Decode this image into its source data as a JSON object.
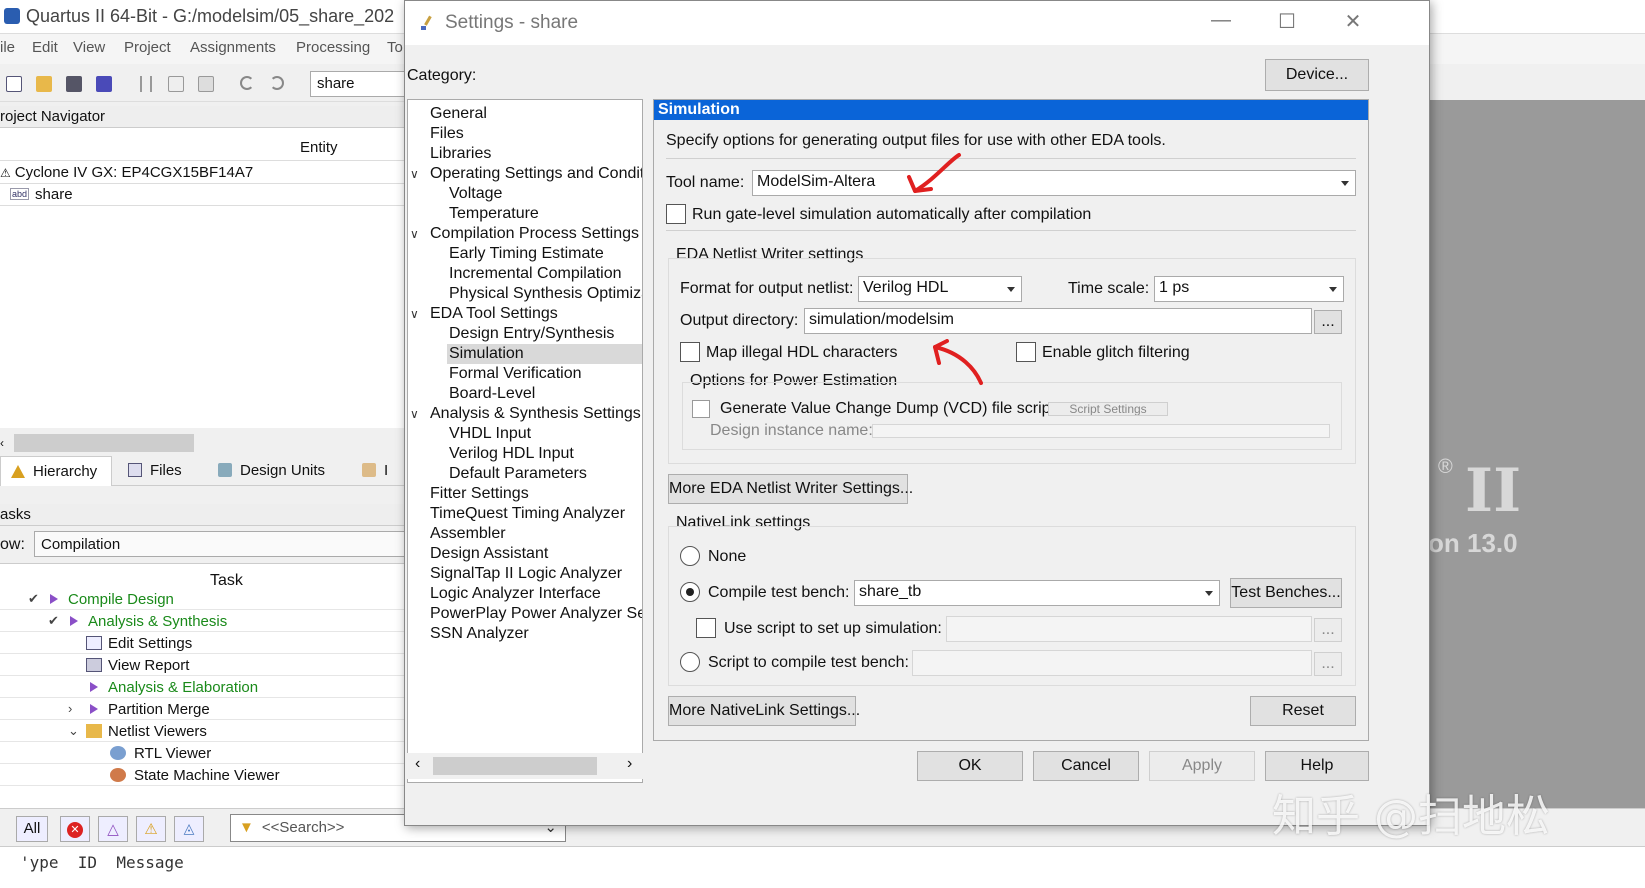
{
  "bg": {
    "title": "Quartus II 64-Bit - G:/modelsim/05_share_202",
    "menu": [
      "ile",
      "Edit",
      "View",
      "Project",
      "Assignments",
      "Processing",
      "To"
    ],
    "toolbar_combo": "share",
    "project_navigator": "roject Navigator",
    "entity_col": "Entity",
    "device": "Cyclone IV GX: EP4CGX15BF14A7",
    "top_entity": "share",
    "tabs": [
      "Hierarchy",
      "Files",
      "Design Units",
      "I"
    ],
    "tasks_header": "asks",
    "flow_label": "ow:",
    "flow_value": "Compilation",
    "task_col": "Task",
    "tasks": [
      {
        "label": "Compile Design"
      },
      {
        "label": "Analysis & Synthesis"
      },
      {
        "label": "Edit Settings"
      },
      {
        "label": "View Report"
      },
      {
        "label": "Analysis & Elaboration"
      },
      {
        "label": "Partition Merge"
      },
      {
        "label": "Netlist Viewers"
      },
      {
        "label": "RTL Viewer"
      },
      {
        "label": "State Machine Viewer"
      }
    ],
    "msg_all": "All",
    "search_placeholder": "<<Search>>",
    "msg_cols": "'ype  ID  Message",
    "splash_reg": "®",
    "splash_ii": "II",
    "splash_version": "on 13.0",
    "watermark": "知乎 @扫地松"
  },
  "dialog": {
    "title": "Settings - share",
    "category_label": "Category:",
    "device_button": "Device...",
    "categories": [
      "General",
      "Files",
      "Libraries",
      "Operating Settings and Conditic",
      "Voltage",
      "Temperature",
      "Compilation Process Settings",
      "Early Timing Estimate",
      "Incremental Compilation",
      "Physical Synthesis Optimizati",
      "EDA Tool Settings",
      "Design Entry/Synthesis",
      "Simulation",
      "Formal Verification",
      "Board-Level",
      "Analysis & Synthesis Settings",
      "VHDL Input",
      "Verilog HDL Input",
      "Default Parameters",
      "Fitter Settings",
      "TimeQuest Timing Analyzer",
      "Assembler",
      "Design Assistant",
      "SignalTap II Logic Analyzer",
      "Logic Analyzer Interface",
      "PowerPlay Power Analyzer Setti",
      "SSN Analyzer"
    ],
    "panel": {
      "header": "Simulation",
      "description": "Specify options for generating output files for use with other EDA tools.",
      "tool_name_label": "Tool name:",
      "tool_name_value": "ModelSim-Altera",
      "run_gate_level": "Run gate-level simulation automatically after compilation",
      "eda_group": "EDA Netlist Writer settings",
      "format_label": "Format for output netlist:",
      "format_value": "Verilog HDL",
      "timescale_label": "Time scale:",
      "timescale_value": "1 ps",
      "output_dir_label": "Output directory:",
      "output_dir_value": "simulation/modelsim",
      "browse": "...",
      "map_illegal": "Map illegal HDL characters",
      "glitch": "Enable glitch filtering",
      "power_group": "Options for Power Estimation",
      "vcd": "Generate Value Change Dump (VCD) file script",
      "script_settings": "Script Settings",
      "design_instance": "Design instance name:",
      "more_eda": "More EDA Netlist Writer Settings...",
      "nativelink_group": "NativeLink settings",
      "none": "None",
      "compile_tb_label": "Compile test bench:",
      "compile_tb_value": "share_tb",
      "test_benches": "Test Benches...",
      "use_script": "Use script to set up simulation:",
      "script_compile": "Script to compile test bench:",
      "more_nativelink": "More NativeLink Settings...",
      "reset": "Reset"
    },
    "ok": "OK",
    "cancel": "Cancel",
    "apply": "Apply",
    "help": "Help"
  }
}
